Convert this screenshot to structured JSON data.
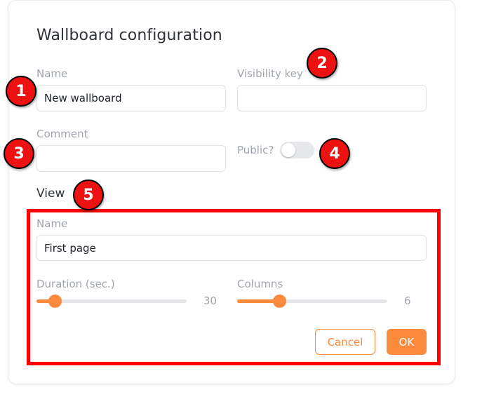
{
  "dialog": {
    "title": "Wallboard configuration",
    "name": {
      "label": "Name",
      "value": "New wallboard"
    },
    "visibility_key": {
      "label": "Visibility key",
      "value": ""
    },
    "comment": {
      "label": "Comment",
      "value": ""
    },
    "public": {
      "label": "Public?",
      "checked": false
    },
    "view": {
      "heading": "View",
      "name": {
        "label": "Name",
        "value": "First page"
      },
      "duration": {
        "label": "Duration (sec.)",
        "value": "30",
        "fraction": 0.12
      },
      "columns": {
        "label": "Columns",
        "value": "6",
        "fraction": 0.28
      },
      "cancel_label": "Cancel",
      "ok_label": "OK"
    }
  },
  "markers": [
    "1",
    "2",
    "3",
    "4",
    "5"
  ],
  "colors": {
    "accent": "#fb8a3c",
    "highlight": "#ff0000",
    "marker": "#ee1111"
  }
}
